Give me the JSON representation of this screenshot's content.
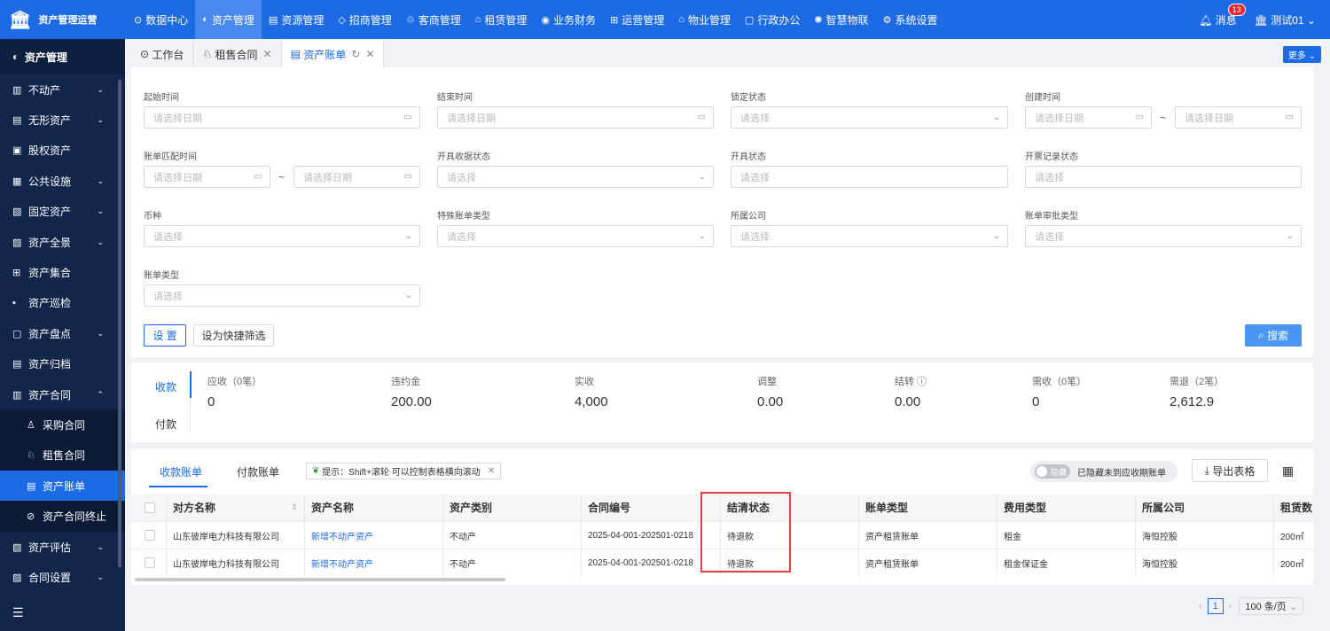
{
  "app": {
    "title": "资产管理运营"
  },
  "nav": [
    {
      "icon": "⊙",
      "label": "数据中心"
    },
    {
      "icon": "◐",
      "label": "资产管理"
    },
    {
      "icon": "▤",
      "label": "资源管理"
    },
    {
      "icon": "◇",
      "label": "招商管理"
    },
    {
      "icon": "♲",
      "label": "客商管理"
    },
    {
      "icon": "⌂",
      "label": "租赁管理"
    },
    {
      "icon": "◉",
      "label": "业务财务"
    },
    {
      "icon": "⊞",
      "label": "运营管理"
    },
    {
      "icon": "⌂",
      "label": "物业管理"
    },
    {
      "icon": "▢",
      "label": "行政办公"
    },
    {
      "icon": "✺",
      "label": "智慧物联"
    },
    {
      "icon": "⚙",
      "label": "系统设置"
    }
  ],
  "header": {
    "msg_label": "消息",
    "msg_count": "13",
    "user": "测试01"
  },
  "sidebar": {
    "title": "资产管理",
    "items": [
      {
        "label": "不动产"
      },
      {
        "label": "无形资产"
      },
      {
        "label": "股权资产"
      },
      {
        "label": "公共设施"
      },
      {
        "label": "固定资产"
      },
      {
        "label": "资产全景"
      },
      {
        "label": "资产集合"
      },
      {
        "label": "资产巡检"
      },
      {
        "label": "资产盘点"
      },
      {
        "label": "资产归档"
      },
      {
        "label": "资产合同"
      }
    ],
    "sub": [
      {
        "label": "采购合同"
      },
      {
        "label": "租售合同"
      },
      {
        "label": "资产账单"
      },
      {
        "label": "资产合同终止"
      }
    ],
    "after": [
      {
        "label": "资产评估"
      },
      {
        "label": "合同设置"
      }
    ],
    "footer_icon": "☰"
  },
  "tabs": [
    {
      "label": "工作台"
    },
    {
      "label": "租售合同"
    },
    {
      "label": "资产账单"
    }
  ],
  "more_label": "更多",
  "filters": {
    "row1": [
      {
        "label": "起始时间",
        "ph": "请选择日期"
      },
      {
        "label": "结束时间",
        "ph": "请选择日期"
      },
      {
        "label": "锁定状态",
        "ph": "请选择"
      },
      {
        "label": "创建时间",
        "ph": "请选择日期",
        "ph2": "请选择日期"
      }
    ],
    "row2": [
      {
        "label": "账单匹配时间",
        "ph": "请选择日期",
        "ph2": "请选择日期"
      },
      {
        "label": "开具收据状态",
        "ph": "请选择"
      },
      {
        "label": "开具状态",
        "ph": "请选择"
      },
      {
        "label": "开票记录状态",
        "ph": "请选择"
      }
    ],
    "row3": [
      {
        "label": "币种",
        "ph": "请选择"
      },
      {
        "label": "特殊账单类型",
        "ph": "请选择"
      },
      {
        "label": "所属公司",
        "ph": "请选择"
      },
      {
        "label": "账单审批类型",
        "ph": "请选择"
      }
    ],
    "row4": [
      {
        "label": "账单类型",
        "ph": "请选择"
      }
    ],
    "tilde": "~",
    "btn_setting": "设 置",
    "btn_quick": "设为快捷筛选",
    "btn_search": "搜索"
  },
  "stats": {
    "tabs": [
      "收款",
      "付款"
    ],
    "items": [
      {
        "label": "应收（0笔）",
        "value": "0"
      },
      {
        "label": "违约金",
        "value": "200.00"
      },
      {
        "label": "实收",
        "value": "4,000"
      },
      {
        "label": "调整",
        "value": "0.00"
      },
      {
        "label": "结转",
        "value": "0.00"
      },
      {
        "label": "需收（0笔）",
        "value": "0"
      },
      {
        "label": "需退（2笔）",
        "value": "2,612.9"
      }
    ]
  },
  "table": {
    "tabs": [
      "收款账单",
      "付款账单"
    ],
    "tip": "提示：Shift+滚轮 可以控制表格横向滚动",
    "toggle_state": "隐藏",
    "toggle_label": "已隐藏未到应收期账单",
    "export_label": "导出表格",
    "columns": [
      "对方名称",
      "资产名称",
      "资产类别",
      "合同编号",
      "结清状态",
      "账单类型",
      "费用类型",
      "所属公司",
      "租赁数"
    ],
    "rows": [
      [
        "山东彼岸电力科技有限公司",
        "新增不动产资产",
        "不动产",
        "2025-04-001-202501-0218",
        "待退款",
        "资产租赁账单",
        "租金",
        "海恒控股",
        "200㎡"
      ],
      [
        "山东彼岸电力科技有限公司",
        "新增不动产资产",
        "不动产",
        "2025-04-001-202501-0218",
        "待退款",
        "资产租赁账单",
        "租金保证金",
        "海恒控股",
        "200㎡"
      ]
    ]
  },
  "pagination": {
    "page": "1",
    "page_size": "100 条/页"
  }
}
